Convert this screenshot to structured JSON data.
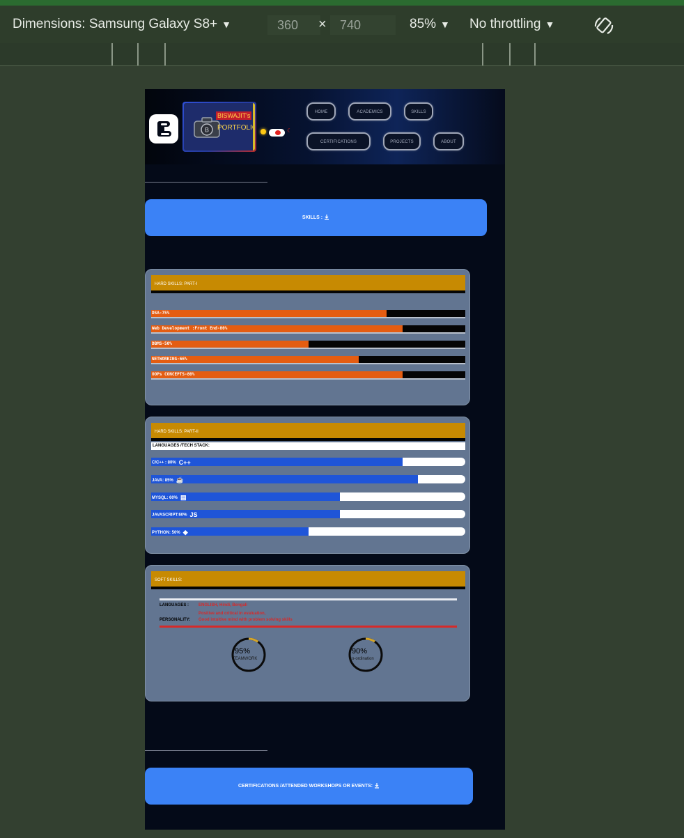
{
  "devtools": {
    "dimensions_label": "Dimensions: Samsung Galaxy S8+",
    "width": "360",
    "times": "×",
    "height": "740",
    "zoom": "85%",
    "throttling": "No throttling",
    "dropdown_arrow": "▼"
  },
  "site": {
    "logo": {
      "name": "BISWAJIT's",
      "sub": "PORTFOLIO"
    },
    "nav": [
      "HOME",
      "ACADEMICS",
      "SKILLS",
      "CERTIFICATIONS",
      "PROJECTS",
      "ABOUT"
    ],
    "skills_banner": "SKILLS :",
    "hard_skills_1": {
      "title": "HARD SKILLS: PART-I",
      "bars": [
        {
          "label": "DSA-75%",
          "value": 75
        },
        {
          "label": "Web Development :Front End-80%",
          "value": 80
        },
        {
          "label": "DBMS-50%",
          "value": 50
        },
        {
          "label": "NETWORKING-66%",
          "value": 66
        },
        {
          "label": "OOPs CONCEPTS-80%",
          "value": 80
        }
      ]
    },
    "hard_skills_2": {
      "title": "HARD SKILLS: PART-II",
      "subtitle": "LANGUAGES /TECH STACK:",
      "bars": [
        {
          "label": "C/C++ : 80%",
          "value": 80,
          "icon_text": "C++",
          "icon": "cpp-icon"
        },
        {
          "label": "JAVA: 85%",
          "value": 85,
          "icon_text": "☕",
          "icon": "java-icon"
        },
        {
          "label": "MYSQL: 60%",
          "value": 60,
          "icon_text": "▤",
          "icon": "database-icon"
        },
        {
          "label": "JAVASCRIPT:60%",
          "value": 60,
          "icon_text": "JS",
          "icon": "javascript-icon"
        },
        {
          "label": "PYTHON: 50%",
          "value": 50,
          "icon_text": "◆",
          "icon": "python-icon"
        }
      ]
    },
    "soft_skills": {
      "title": "SOFT SKILLS:",
      "languages_label": "LANGUAGES :",
      "languages_value": "ENGLISH, Hindi, Bengali",
      "personality_line1": "Positive and critical in evaluation,",
      "personality_label": "PERSONALITY:",
      "personality_value": "Good intuitive mind with problem solving skills",
      "rings": [
        {
          "percent": "95%",
          "label": "TEAMWORK",
          "value": 95
        },
        {
          "percent": "90%",
          "label": "co-ordination",
          "value": 90
        }
      ]
    },
    "certifications_banner": "CERTIFICATIONS /ATTENDED WORKSHOPS OR EVENTS:"
  },
  "colors": {
    "banner": "#3b82f6",
    "card_header": "#c78a02",
    "orange_fill": "#e45d12",
    "blue_fill": "#1f55d8",
    "card_bg": "#627591",
    "soft_red": "#d62a2a"
  }
}
